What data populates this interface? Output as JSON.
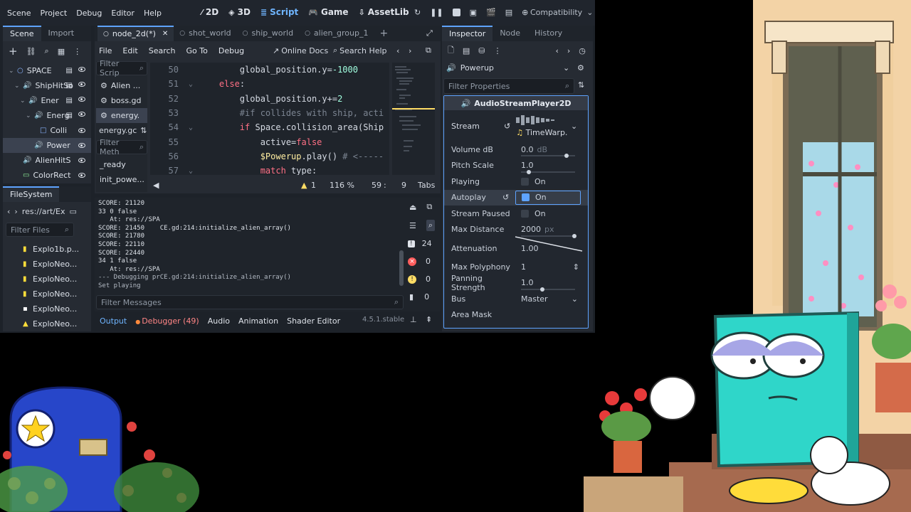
{
  "menu": [
    "Scene",
    "Project",
    "Debug",
    "Editor",
    "Help"
  ],
  "modes": [
    {
      "label": "2D",
      "icon": "2d-icon",
      "active": false
    },
    {
      "label": "3D",
      "icon": "3d-icon",
      "active": false
    },
    {
      "label": "Script",
      "icon": "script-icon",
      "active": true
    },
    {
      "label": "Game",
      "icon": "game-icon",
      "active": false
    },
    {
      "label": "AssetLib",
      "icon": "assetlib-icon",
      "active": false
    }
  ],
  "renderer": "Compatibility",
  "scene_dock": {
    "tabs": [
      "Scene",
      "Import"
    ],
    "nodes": [
      {
        "label": "SPACE",
        "indent": 0
      },
      {
        "label": "ShipHitSo",
        "indent": 1
      },
      {
        "label": "Ener",
        "indent": 2
      },
      {
        "label": "Energ",
        "indent": 3
      },
      {
        "label": "Colli",
        "indent": 4
      },
      {
        "label": "Power",
        "indent": 3
      },
      {
        "label": "AlienHitS",
        "indent": 1
      },
      {
        "label": "ColorRect",
        "indent": 1
      }
    ]
  },
  "filesystem": {
    "title": "FileSystem",
    "path": "res://art/Ex",
    "filter_placeholder": "Filter Files",
    "files": [
      "Explo1b.p...",
      "ExploNeo...",
      "ExploNeo...",
      "ExploNeo...",
      "ExploNeo...",
      "ExploNeo..."
    ]
  },
  "script_tabs": [
    "node_2d(*)",
    "shot_world",
    "ship_world",
    "alien_group_1"
  ],
  "script_menu": [
    "File",
    "Edit",
    "Search",
    "Go To",
    "Debug"
  ],
  "online_docs": "Online Docs",
  "search_help": "Search Help",
  "script_list": {
    "filter_placeholder": "Filter Scrip",
    "items": [
      "Alien ...",
      "boss.gd",
      "energy."
    ],
    "current": "energy.gc",
    "method_filter": "Filter Meth",
    "methods": [
      "_ready",
      "init_powe..."
    ]
  },
  "code": {
    "lines": [
      {
        "n": "50",
        "text": "        global_position.y=-1000"
      },
      {
        "n": "51",
        "text": "    else:"
      },
      {
        "n": "52",
        "text": "        global_position.y+=2"
      },
      {
        "n": "53",
        "text": "        #if collides with ship, acti"
      },
      {
        "n": "54",
        "text": "        if Space.collision_area(Ship"
      },
      {
        "n": "55",
        "text": "            active=false"
      },
      {
        "n": "56",
        "text": "            $Powerup.play() # <-----"
      },
      {
        "n": "57",
        "text": "            match type:"
      }
    ],
    "status": {
      "warnings": "1",
      "zoom": "116 %",
      "line": "59",
      "col": "9",
      "indent": "Tabs"
    }
  },
  "output": {
    "lines": [
      "SCORE: 21120",
      "33 0 false",
      "   At: res://SPA",
      "SCORE: 21450    CE.gd:214:initialize_alien_array()",
      "SCORE: 21780",
      "SCORE: 22110",
      "SCORE: 22440",
      "34 1 false",
      "   At: res://SPA",
      "--- Debugging prCE.gd:214:initialize_alien_array()",
      "Set playing"
    ],
    "counts": {
      "messages": "24",
      "errors": "0",
      "warnings": "0",
      "info": "0"
    },
    "filter_placeholder": "Filter Messages"
  },
  "bottom_tabs": [
    "Output",
    "Debugger (49)",
    "Audio",
    "Animation",
    "Shader Editor"
  ],
  "version": "4.5.1.stable",
  "inspector": {
    "tabs": [
      "Inspector",
      "Node",
      "History"
    ],
    "node": "Powerup",
    "filter_placeholder": "Filter Properties",
    "class": "AudioStreamPlayer2D",
    "stream_label": "Stream",
    "stream_value": "TimeWarp.",
    "props": [
      {
        "label": "Volume dB",
        "value": "0.0",
        "unit": "dB",
        "kind": "slider",
        "level": 0.8
      },
      {
        "label": "Pitch Scale",
        "value": "1.0",
        "unit": "",
        "kind": "slider",
        "level": 0.1
      },
      {
        "label": "Playing",
        "value": "On",
        "kind": "check",
        "checked": false
      },
      {
        "label": "Autoplay",
        "value": "On",
        "kind": "check",
        "checked": true
      },
      {
        "label": "Stream Paused",
        "value": "On",
        "kind": "check",
        "checked": false
      },
      {
        "label": "Max Distance",
        "value": "2000",
        "unit": "px",
        "kind": "slider",
        "level": 0.95
      },
      {
        "label": "Attenuation",
        "value": "1.00",
        "kind": "curve"
      },
      {
        "label": "Max Polyphony",
        "value": "1",
        "kind": "spin"
      },
      {
        "label": "Panning Strength",
        "value": "1.0",
        "unit": "",
        "kind": "slider",
        "level": 0.35
      },
      {
        "label": "Bus",
        "value": "Master",
        "kind": "select"
      },
      {
        "label": "Area Mask",
        "value": "",
        "kind": "none"
      }
    ]
  },
  "colors": {
    "accent": "#5ea3ff",
    "error": "#ff5d5d",
    "warning": "#ffdd65",
    "bg": "#1d2229"
  }
}
